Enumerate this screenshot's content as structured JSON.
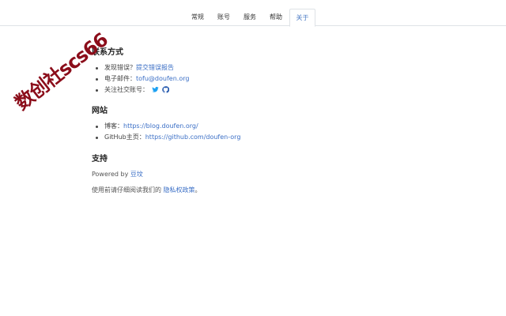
{
  "tabs": [
    {
      "label": "常规",
      "active": false
    },
    {
      "label": "账号",
      "active": false
    },
    {
      "label": "服务",
      "active": false
    },
    {
      "label": "帮助",
      "active": false
    },
    {
      "label": "关于",
      "active": true
    }
  ],
  "contact": {
    "title": "联系方式",
    "bug_prefix": "发现错误？",
    "bug_link": "提交错误报告",
    "email_prefix": "电子邮件：",
    "email_link": "tofu@doufen.org",
    "social_prefix": "关注社交账号："
  },
  "websites": {
    "title": "网站",
    "blog_prefix": "博客：",
    "blog_link": "https://blog.doufen.org/",
    "github_prefix": "GitHub主页：",
    "github_link": "https://github.com/doufen-org"
  },
  "support": {
    "title": "支持",
    "powered_prefix": "Powered by ",
    "powered_link": "豆坟",
    "privacy_prefix": "使用前请仔细阅读我们的 ",
    "privacy_link": "隐私权政策",
    "privacy_suffix": "。"
  },
  "watermark": "数创社scs66",
  "colors": {
    "link": "#3b6fc6",
    "active_tab": "#4a79c4",
    "twitter": "#1da1f2",
    "github": "#2a5db0",
    "watermark": "#8b0d1a"
  }
}
